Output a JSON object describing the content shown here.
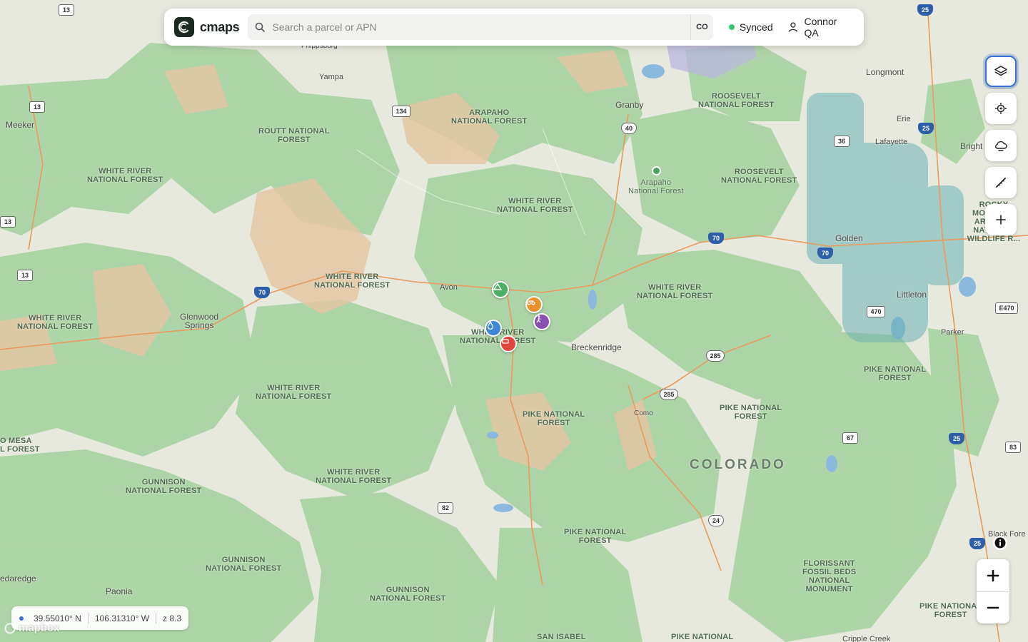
{
  "app": {
    "brand": "cmaps",
    "search": {
      "placeholder": "Search a parcel or APN",
      "state_code": "CO"
    },
    "sync_status": "Synced",
    "user_name": "Connor QA"
  },
  "tools": [
    {
      "name": "layers-icon",
      "active": true
    },
    {
      "name": "locate-icon",
      "active": false
    },
    {
      "name": "weather-icon",
      "active": false
    },
    {
      "name": "measure-icon",
      "active": false
    },
    {
      "name": "add-icon",
      "active": false
    }
  ],
  "coords": {
    "lat": "39.55010° N",
    "lon": "106.31310° W",
    "zoom": "z 8.3"
  },
  "attribution": "mapbox",
  "map_labels": {
    "state": "COLORADO",
    "forests": [
      "ROUTT NATIONAL\nFOREST",
      "WHITE RIVER\nNATIONAL FOREST",
      "ARAPAHO\nNATIONAL FOREST",
      "ROOSEVELT\nNATIONAL FOREST",
      "ROOSEVELT\nNATIONAL FOREST",
      "WHITE RIVER\nNATIONAL FOREST",
      "WHITE RIVER\nNATIONAL FOREST",
      "WHITE RIVER\nNATIONAL FOREST",
      "WHITE RIVER\nNATIONAL FOREST",
      "WHITE RIVER\nNATIONAL FOREST",
      "WHITE RIVER\nNATIONAL FOREST",
      "WHITE RIVER\nNATIONAL FOREST",
      "PIKE NATIONAL\nFOREST",
      "PIKE NATIONAL\nFOREST",
      "PIKE NATIONAL\nFOREST",
      "PIKE NATIONAL\nFOREST",
      "GUNNISON\nNATIONAL FOREST",
      "GUNNISON\nNATIONAL FOREST",
      "GUNNISON\nNATIONAL FOREST",
      "PIKE NATIONAL\nFOREST",
      "FLORISSANT\nFOSSIL BEDS\nNATIONAL\nMONUMENT",
      "ROCKY MOUNTAIN\nARSENAL NATIONAL\nWILDLIFE R...",
      "O MESA\nL FOREST",
      "SAN ISABEL",
      "PIKE NATIONAL",
      "WHITE RIVER\nNATIONAL FOREST"
    ],
    "towns": [
      "Meeker",
      "Phippsburg",
      "Yampa",
      "Granby",
      "Longmont",
      "Erie",
      "Lafayette",
      "Bright",
      "Golden",
      "Littleton",
      "Parker",
      "Glenwood\nSprings",
      "Avon",
      "Breckenridge",
      "Como",
      "Paonia",
      "edaredge",
      "Black Fore",
      "Cripple Creek"
    ],
    "small_forest": "Arapaho\nNational Forest",
    "shields": [
      "13",
      "13",
      "13",
      "13",
      "134",
      "40",
      "25",
      "25",
      "36",
      "70",
      "70",
      "70",
      "285",
      "285",
      "470",
      "E470",
      "24",
      "67",
      "25",
      "83",
      "82",
      "25",
      "25"
    ]
  },
  "poi_markers": [
    {
      "name": "campground-icon",
      "color": "#4caf63"
    },
    {
      "name": "atv-icon",
      "color": "#e8922e"
    },
    {
      "name": "hiker-icon",
      "color": "#8a4fb5"
    },
    {
      "name": "water-icon",
      "color": "#3f87d6"
    },
    {
      "name": "vehicle-icon",
      "color": "#e0463b"
    }
  ],
  "colors": {
    "public_land": "#a9d3a2",
    "private_land": "#e3c7a3",
    "accent": "#3b6fd3",
    "synced": "#35c56a"
  }
}
